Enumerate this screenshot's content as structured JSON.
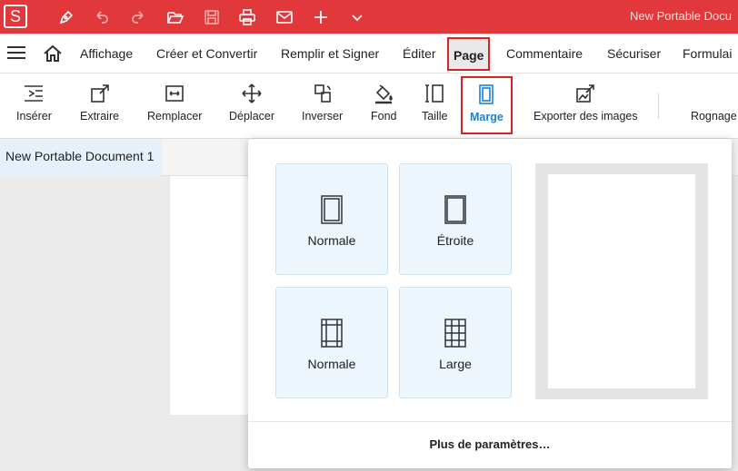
{
  "titlebar": {
    "logo": "S",
    "doc_title": "New Portable Docu",
    "icons": [
      "pen-icon",
      "undo-icon",
      "redo-icon",
      "folder-open-icon",
      "save-icon",
      "print-icon",
      "mail-icon",
      "plus-icon",
      "chevron-down-icon"
    ]
  },
  "menu": {
    "items": [
      "Affichage",
      "Créer et Convertir",
      "Remplir et Signer",
      "Éditer",
      "Page",
      "Commentaire",
      "Sécuriser",
      "Formulai"
    ]
  },
  "toolbar": {
    "tools": [
      "Insérer",
      "Extraire",
      "Remplacer",
      "Déplacer",
      "Inverser",
      "Fond",
      "Taille",
      "Marge",
      "Exporter des images",
      "Rognage de"
    ]
  },
  "tab": {
    "label": "New Portable Document 1"
  },
  "margin_popup": {
    "presets": [
      "Normale",
      "Étroite",
      "Normale",
      "Large"
    ],
    "more_settings": "Plus de paramètres…"
  },
  "colors": {
    "titlebar": "#e1383c",
    "active_blue": "#1f7fd6",
    "highlight_red": "#e02020"
  }
}
